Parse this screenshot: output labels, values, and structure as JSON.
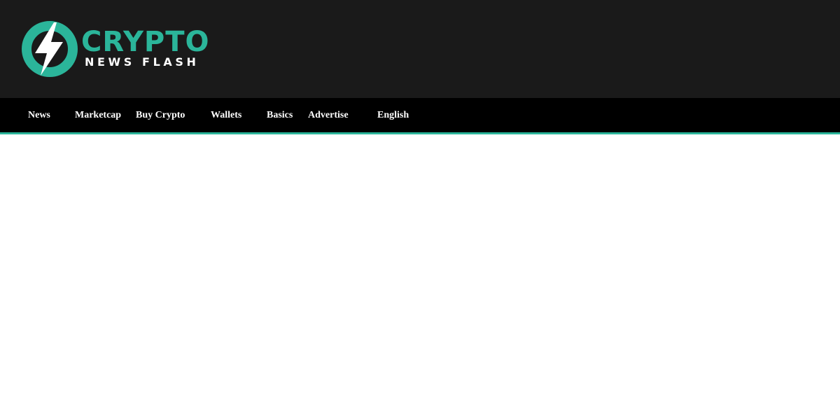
{
  "brand": {
    "name_main": "CRYPTO",
    "name_sub": "NEWS FLASH",
    "logo_icon": "lightning-bolt-icon",
    "accent_color": "#2bb59a",
    "header_bg": "#1a1a1a",
    "nav_bg": "#000000"
  },
  "nav": {
    "items": [
      {
        "label": "News"
      },
      {
        "label": "Marketcap"
      },
      {
        "label": "Buy Crypto"
      },
      {
        "label": "Wallets"
      },
      {
        "label": "Basics"
      },
      {
        "label": "Advertise"
      },
      {
        "label": "English"
      }
    ]
  }
}
